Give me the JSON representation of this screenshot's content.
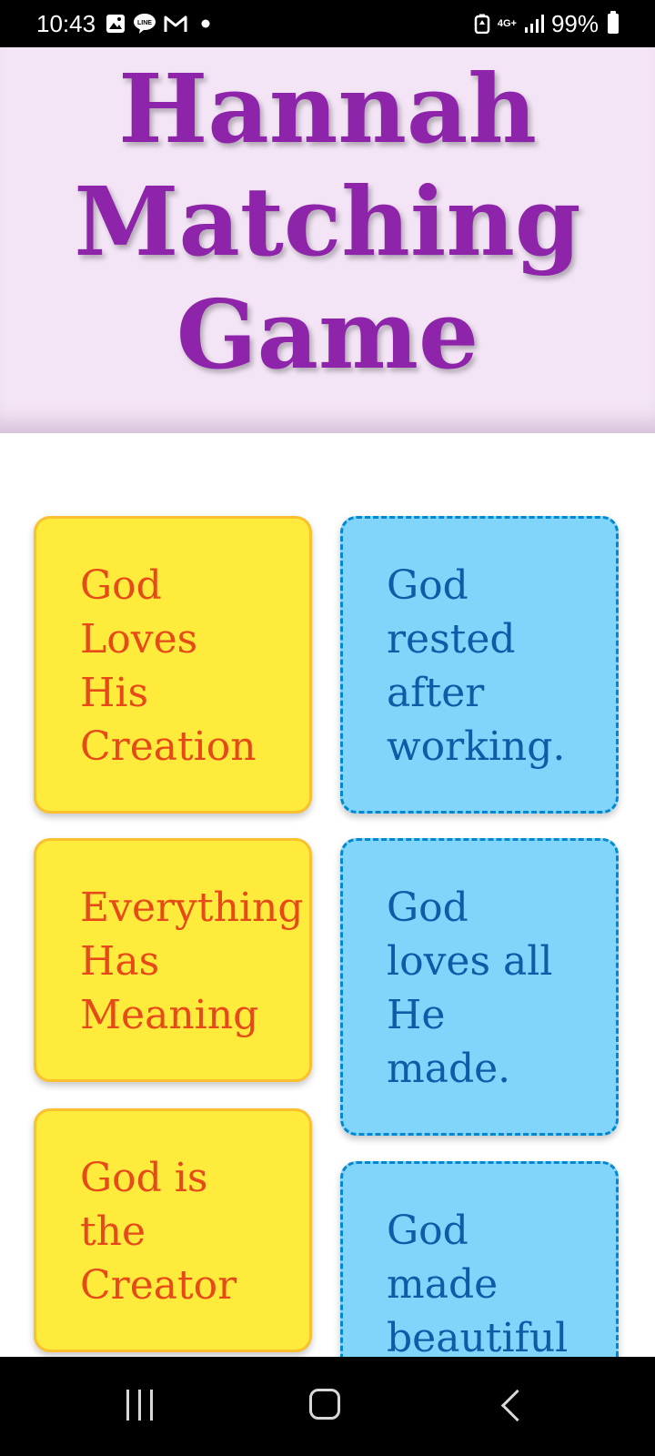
{
  "status_bar": {
    "time": "10:43",
    "left_icons": [
      "gallery-icon",
      "line-icon",
      "gmail-icon",
      "dot-icon"
    ],
    "network": "4G+",
    "battery": "99%"
  },
  "header": {
    "title": "Hannah Matching Game",
    "background": "#f3e5f5",
    "title_color": "#8e24aa"
  },
  "cards": {
    "left": [
      {
        "text": "God\nLoves\nHis\nCreation"
      },
      {
        "text": "Everything\nHas\nMeaning"
      },
      {
        "text": "God is\nthe\nCreator"
      }
    ],
    "right": [
      {
        "text": "God\nrested\nafter\nworking."
      },
      {
        "text": "God\nloves all\nHe\nmade."
      },
      {
        "text": "God\nmade\nbeautiful"
      }
    ],
    "left_color": "#ffeb3b",
    "left_text_color": "#e64a19",
    "right_color": "#81d4fa",
    "right_text_color": "#0d5ca8"
  },
  "nav_bar": {
    "buttons": [
      "recents-icon",
      "home-icon",
      "back-icon"
    ]
  }
}
